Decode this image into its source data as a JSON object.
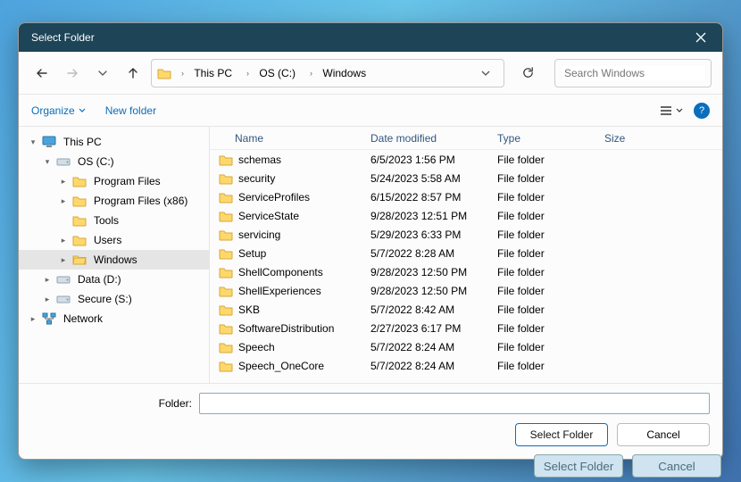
{
  "title": "Select Folder",
  "breadcrumb": [
    "This PC",
    "OS (C:)",
    "Windows"
  ],
  "search_placeholder": "Search Windows",
  "toolbar": {
    "organize": "Organize",
    "new_folder": "New folder"
  },
  "tree": [
    {
      "label": "This PC",
      "depth": 0,
      "icon": "pc",
      "twist": "open",
      "sel": false
    },
    {
      "label": "OS (C:)",
      "depth": 1,
      "icon": "drive",
      "twist": "open",
      "sel": false
    },
    {
      "label": "Program Files",
      "depth": 2,
      "icon": "folder",
      "twist": "closed",
      "sel": false
    },
    {
      "label": "Program Files (x86)",
      "depth": 2,
      "icon": "folder",
      "twist": "closed",
      "sel": false
    },
    {
      "label": "Tools",
      "depth": 2,
      "icon": "folder",
      "twist": "none",
      "sel": false
    },
    {
      "label": "Users",
      "depth": 2,
      "icon": "folder",
      "twist": "closed",
      "sel": false
    },
    {
      "label": "Windows",
      "depth": 2,
      "icon": "folder-open",
      "twist": "closed",
      "sel": true
    },
    {
      "label": "Data (D:)",
      "depth": 1,
      "icon": "drive",
      "twist": "closed",
      "sel": false
    },
    {
      "label": "Secure (S:)",
      "depth": 1,
      "icon": "drive",
      "twist": "closed",
      "sel": false
    },
    {
      "label": "Network",
      "depth": 0,
      "icon": "network",
      "twist": "closed",
      "sel": false
    }
  ],
  "columns": {
    "name": "Name",
    "date": "Date modified",
    "type": "Type",
    "size": "Size"
  },
  "rows": [
    {
      "name": "schemas",
      "date": "6/5/2023 1:56 PM",
      "type": "File folder"
    },
    {
      "name": "security",
      "date": "5/24/2023 5:58 AM",
      "type": "File folder"
    },
    {
      "name": "ServiceProfiles",
      "date": "6/15/2022 8:57 PM",
      "type": "File folder"
    },
    {
      "name": "ServiceState",
      "date": "9/28/2023 12:51 PM",
      "type": "File folder"
    },
    {
      "name": "servicing",
      "date": "5/29/2023 6:33 PM",
      "type": "File folder"
    },
    {
      "name": "Setup",
      "date": "5/7/2022 8:28 AM",
      "type": "File folder"
    },
    {
      "name": "ShellComponents",
      "date": "9/28/2023 12:50 PM",
      "type": "File folder"
    },
    {
      "name": "ShellExperiences",
      "date": "9/28/2023 12:50 PM",
      "type": "File folder"
    },
    {
      "name": "SKB",
      "date": "5/7/2022 8:42 AM",
      "type": "File folder"
    },
    {
      "name": "SoftwareDistribution",
      "date": "2/27/2023 6:17 PM",
      "type": "File folder"
    },
    {
      "name": "Speech",
      "date": "5/7/2022 8:24 AM",
      "type": "File folder"
    },
    {
      "name": "Speech_OneCore",
      "date": "5/7/2022 8:24 AM",
      "type": "File folder"
    }
  ],
  "folder_label": "Folder:",
  "folder_value": "",
  "buttons": {
    "select": "Select Folder",
    "cancel": "Cancel"
  }
}
